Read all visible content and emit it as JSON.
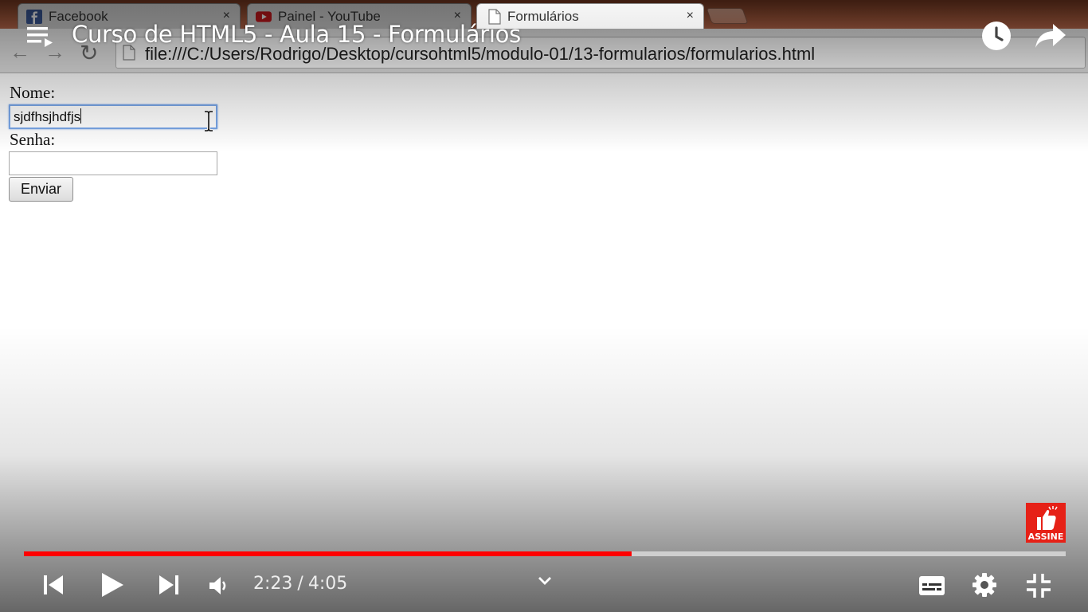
{
  "browser": {
    "tabs": [
      {
        "title": "Facebook",
        "close": "×",
        "active": false
      },
      {
        "title": "Painel - YouTube",
        "close": "×",
        "active": false
      },
      {
        "title": "Formulários",
        "close": "×",
        "active": true
      }
    ],
    "url": "file:///C:/Users/Rodrigo/Desktop/cursohtml5/modulo-01/13-formularios/formularios.html"
  },
  "form": {
    "nome_label": "Nome:",
    "nome_value": "sjdfhsjhdfjs",
    "senha_label": "Senha:",
    "senha_value": "",
    "submit_label": "Enviar"
  },
  "player": {
    "title": "Curso de HTML5 - Aula 15 - Formulários",
    "current_time": "2:23",
    "separator": "/",
    "duration": "4:05",
    "progress_fraction": 0.583,
    "subscribe_label": "ASSINE",
    "accent_color": "#ff0000",
    "icons": [
      "playlist-icon",
      "watch-later-icon",
      "share-icon",
      "previous-icon",
      "play-icon",
      "next-icon",
      "volume-icon",
      "chevron-down-icon",
      "captions-icon",
      "settings-icon",
      "exit-fullscreen-icon"
    ]
  }
}
